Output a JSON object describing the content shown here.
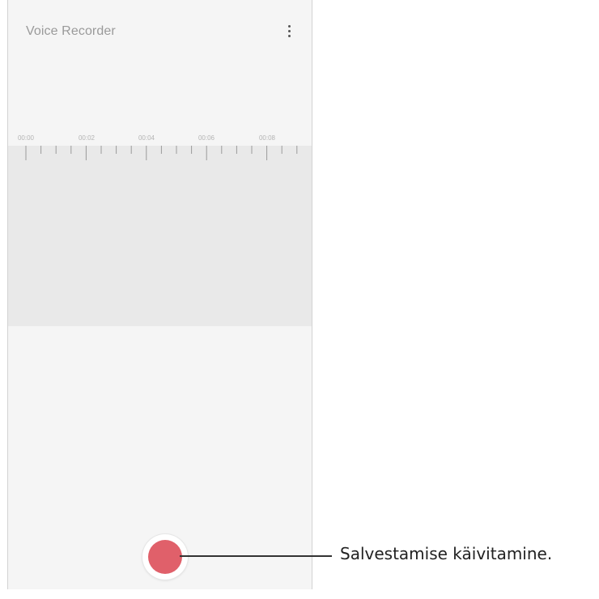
{
  "app": {
    "title": "Voice Recorder",
    "more_icon": "more-vertical-icon"
  },
  "timeline": {
    "labels": [
      "00:00",
      "00:02",
      "00:04",
      "00:06",
      "00:08"
    ]
  },
  "record_button": {
    "icon": "record-icon",
    "color": "#e0606a"
  },
  "callout": {
    "text": "Salvestamise käivitamine."
  },
  "colors": {
    "screen_background": "#f5f5f5",
    "waveform_background": "#e9e9e9",
    "record": "#e0606a"
  }
}
